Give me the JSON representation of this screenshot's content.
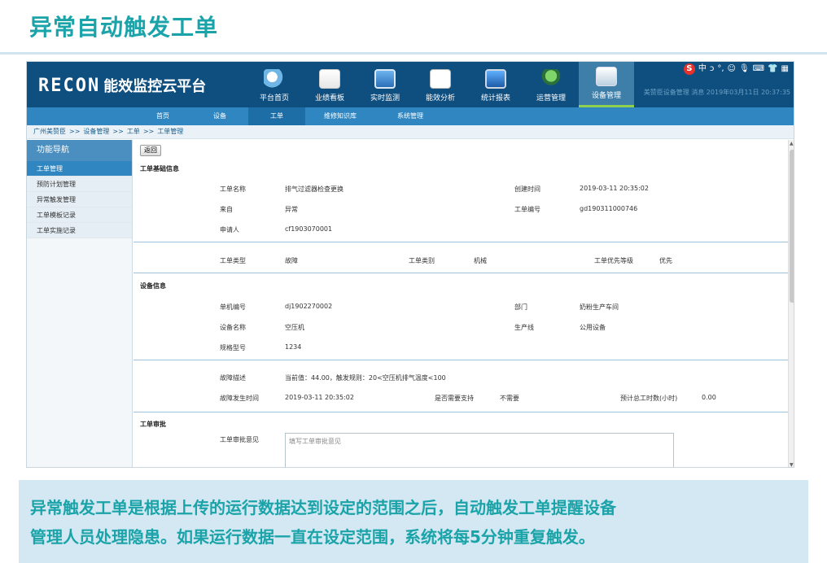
{
  "slide": {
    "title": "异常自动触发工单",
    "caption_line1": "异常触发工单是根据上传的运行数据达到设定的范围之后，自动触发工单提醒设备",
    "caption_line2": "管理人员处理隐患。如果运行数据一直在设定范围，系统将每5分钟重复触发。"
  },
  "app": {
    "brand": "RECON",
    "platform_name": "能效监控云平台",
    "top_nav": [
      {
        "label": "平台首页",
        "icon": "globe-magnifier-icon"
      },
      {
        "label": "业绩看板",
        "icon": "document-chart-icon"
      },
      {
        "label": "实时监测",
        "icon": "monitor-line-chart-icon"
      },
      {
        "label": "能效分析",
        "icon": "bar-chart-board-icon"
      },
      {
        "label": "统计报表",
        "icon": "report-screen-icon"
      },
      {
        "label": "运营管理",
        "icon": "person-gear-icon"
      },
      {
        "label": "设备管理",
        "icon": "device-server-icon",
        "active": true
      }
    ],
    "tray_icons": [
      "S",
      "中",
      "ɔ",
      "°,",
      "☺",
      "🎙",
      "⌨",
      "👕",
      "▦"
    ],
    "user_info": "美赞臣设备管理 消息 2019年03月11日 20:37:35",
    "sub_nav": [
      {
        "label": "首页"
      },
      {
        "label": "设备"
      },
      {
        "label": "工单",
        "active": true
      },
      {
        "label": "维修知识库"
      },
      {
        "label": "系统管理"
      }
    ],
    "breadcrumb": [
      "广州美赞臣",
      ">>",
      "设备管理",
      ">>",
      "工单",
      ">>",
      "工单管理"
    ],
    "sidebar": {
      "header": "功能导航",
      "items": [
        {
          "label": "工单管理",
          "active": true
        },
        {
          "label": "预防计划管理"
        },
        {
          "label": "异常触发管理"
        },
        {
          "label": "工单模板记录"
        },
        {
          "label": "工单实施记录"
        }
      ]
    },
    "back_button": "返回",
    "form": {
      "basic_header": "工单基础信息",
      "name_label": "工单名称",
      "name_value": "排气过滤器检查更换",
      "created_label": "创建时间",
      "created_value": "2019-03-11 20:35:02",
      "source_label": "来自",
      "source_value": "异常",
      "number_label": "工单编号",
      "number_value": "gd190311000746",
      "applicant_label": "申请人",
      "applicant_value": "cf1903070001",
      "type_label": "工单类型",
      "type_value": "故障",
      "category_label": "工单类别",
      "category_value": "机械",
      "priority_label": "工单优先等级",
      "priority_value": "优先",
      "device_header": "设备信息",
      "device_no_label": "单机编号",
      "device_no_value": "dj1902270002",
      "dept_label": "部门",
      "dept_value": "奶粉生产车间",
      "device_name_label": "设备名称",
      "device_name_value": "空压机",
      "line_label": "生产线",
      "line_value": "公用设备",
      "model_label": "规格型号",
      "model_value": "1234",
      "fault_desc_label": "故障描述",
      "fault_desc_value": "当前值：44.00，触发规则：20<空压机排气温度<100",
      "fault_time_label": "故障发生时间",
      "fault_time_value": "2019-03-11 20:35:02",
      "support_label": "是否需要支持",
      "support_value": "不需要",
      "hours_label": "预计总工时数(小时)",
      "hours_value": "0.00",
      "approval_header": "工单审批",
      "approval_label": "工单审批意见",
      "approval_placeholder": "填写工单审批意见"
    }
  }
}
